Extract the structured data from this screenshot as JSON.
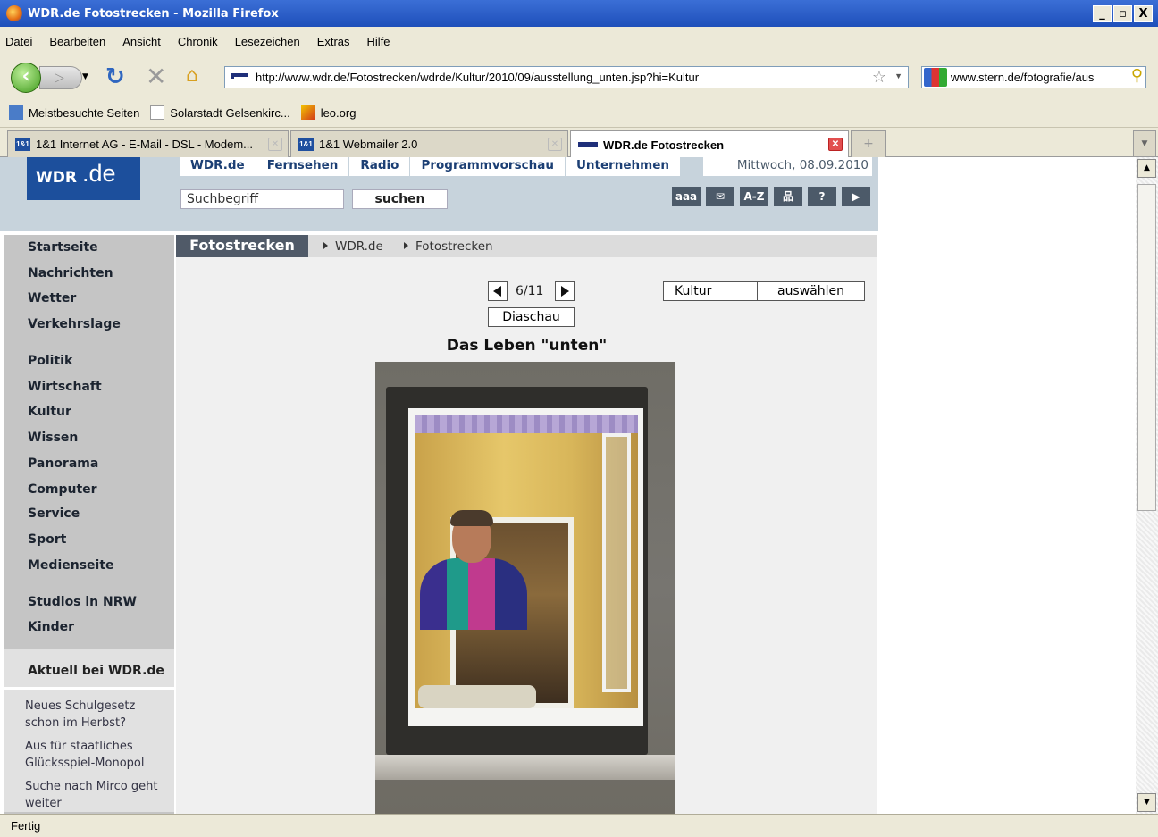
{
  "window": {
    "title": "WDR.de Fotostrecken - Mozilla Firefox",
    "buttons": [
      "_",
      "̅",
      "X"
    ]
  },
  "menu": [
    "Datei",
    "Bearbeiten",
    "Ansicht",
    "Chronik",
    "Lesezeichen",
    "Extras",
    "Hilfe"
  ],
  "nav": {
    "url": "http://www.wdr.de/Fotostrecken/wdrde/Kultur/2010/09/ausstellung_unten.jsp?hi=Kultur",
    "search": "www.stern.de/fotografie/aus"
  },
  "bookmarks": [
    "Meistbesuchte Seiten",
    "Solarstadt Gelsenkirc...",
    "leo.org"
  ],
  "tabs": [
    {
      "title": "1&1 Internet AG - E-Mail - DSL - Modem...",
      "icon": "1&1"
    },
    {
      "title": "1&1 Webmailer 2.0",
      "icon": "1&1"
    },
    {
      "title": "WDR.de Fotostrecken"
    }
  ],
  "status": "Fertig",
  "page": {
    "logo_wdr": "WDR",
    "logo_de": ".de",
    "topnav": [
      "WDR.de",
      "Fernsehen",
      "Radio",
      "Programmvorschau",
      "Unternehmen"
    ],
    "date": "Mittwoch, 08.09.2010",
    "search_placeholder": "Suchbegriff",
    "search_button": "suchen",
    "tools": [
      {
        "label": "aaa",
        "icon": "font-size-icon"
      },
      {
        "label": "✉",
        "icon": "mail-icon"
      },
      {
        "label": "A-Z",
        "icon": "az-index-icon"
      },
      {
        "label": "品",
        "icon": "sitemap-icon"
      },
      {
        "label": "?",
        "icon": "help-icon"
      },
      {
        "label": "▶",
        "icon": "play-icon"
      }
    ],
    "sidebar": [
      "Startseite",
      "Nachrichten",
      "Wetter",
      "Verkehrslage",
      "Politik",
      "Wirtschaft",
      "Kultur",
      "Wissen",
      "Panorama",
      "Computer",
      "Service",
      "Sport",
      "Medienseite",
      "Studios in NRW",
      "Kinder"
    ],
    "aktuell": {
      "heading": "Aktuell bei WDR.de",
      "items": [
        "Neues Schulgesetz schon im Herbst?",
        "Aus für staatliches Glücksspiel-Monopol",
        "Suche nach Mirco geht weiter"
      ]
    },
    "section": "Fotostrecken",
    "breadcrumb": [
      "WDR.de",
      "Fotostrecken"
    ],
    "counter": "6/11",
    "diaschau": "Diaschau",
    "category": "Kultur",
    "select_button": "auswählen",
    "photo_title": "Das Leben \"unten\""
  }
}
